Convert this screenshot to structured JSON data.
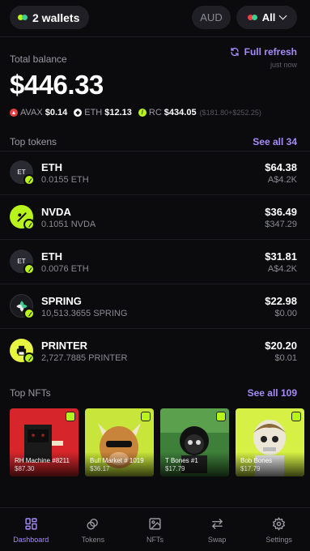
{
  "header": {
    "wallets_label": "2 wallets",
    "currency_label": "AUD",
    "filter_label": "All"
  },
  "balance": {
    "label": "Total balance",
    "value": "$446.33",
    "refresh_label": "Full refresh",
    "refresh_time": "just now",
    "chains": [
      {
        "name": "AVAX",
        "value": "$0.14",
        "extra": ""
      },
      {
        "name": "ETH",
        "value": "$12.13",
        "extra": ""
      },
      {
        "name": "RC",
        "value": "$434.05",
        "extra": "($181.80+$252.25)"
      }
    ]
  },
  "top_tokens": {
    "title": "Top tokens",
    "see_all": "See all 34",
    "items": [
      {
        "name": "ETH",
        "amount": "0.0155 ETH",
        "value": "$64.38",
        "fiat": "A$4.2K",
        "icon_text": "ET"
      },
      {
        "name": "NVDA",
        "amount": "0.1051 NVDA",
        "value": "$36.49",
        "fiat": "$347.29",
        "icon_text": ""
      },
      {
        "name": "ETH",
        "amount": "0.0076 ETH",
        "value": "$31.81",
        "fiat": "A$4.2K",
        "icon_text": "ET"
      },
      {
        "name": "SPRING",
        "amount": "10,513.3655 SPRING",
        "value": "$22.98",
        "fiat": "$0.00",
        "icon_text": ""
      },
      {
        "name": "PRINTER",
        "amount": "2,727.7885 PRINTER",
        "value": "$20.20",
        "fiat": "$0.01",
        "icon_text": ""
      }
    ]
  },
  "top_nfts": {
    "title": "Top NFTs",
    "see_all": "See all 109",
    "items": [
      {
        "name": "RH Machine #8211",
        "price": "$87.30"
      },
      {
        "name": "Bull Market # 1019",
        "price": "$36.17"
      },
      {
        "name": "T Bones #1",
        "price": "$17.79"
      },
      {
        "name": "Bob Bones",
        "price": "$17.79"
      }
    ]
  },
  "nav": [
    {
      "label": "Dashboard",
      "icon": "dashboard-icon",
      "active": true
    },
    {
      "label": "Tokens",
      "icon": "tokens-icon",
      "active": false
    },
    {
      "label": "NFTs",
      "icon": "image-icon",
      "active": false
    },
    {
      "label": "Swap",
      "icon": "swap-icon",
      "active": false
    },
    {
      "label": "Settings",
      "icon": "gear-icon",
      "active": false
    }
  ],
  "colors": {
    "accent": "#a78bfa",
    "lime": "#b8f31b",
    "background": "#0b0b0e",
    "avax": "#e84142"
  }
}
